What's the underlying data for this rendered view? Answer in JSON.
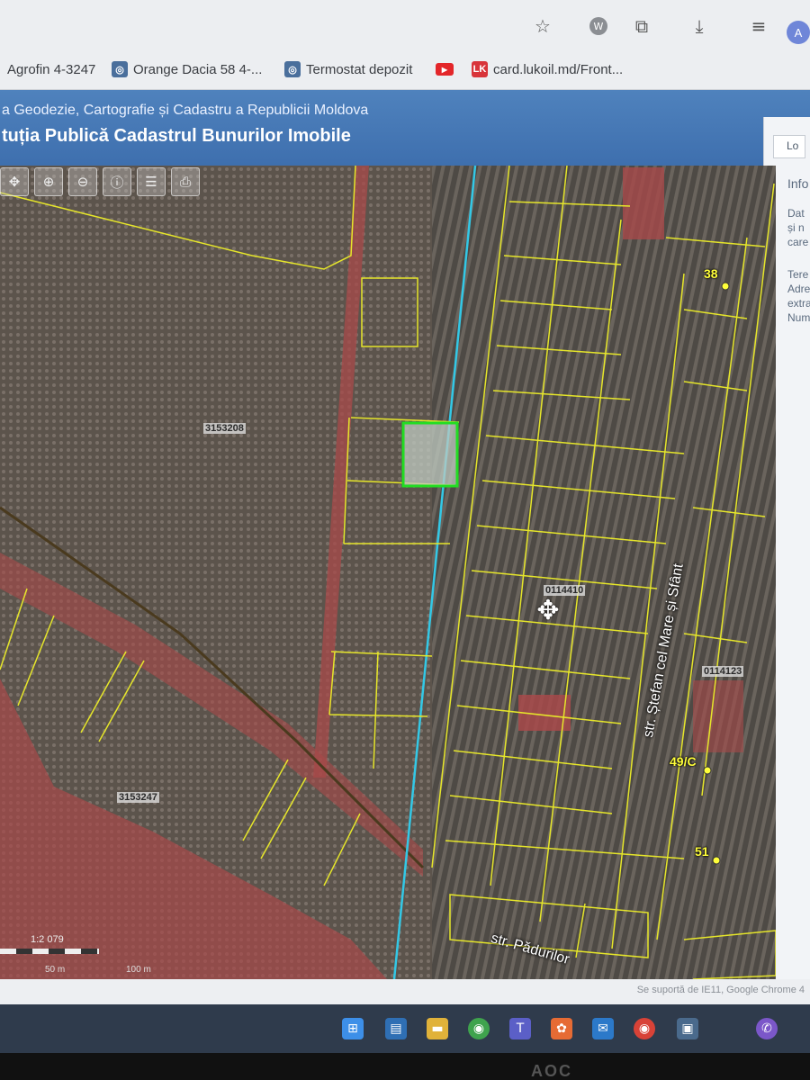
{
  "browser": {
    "toolbar_icons": [
      "star-icon",
      "extension-w-icon",
      "extensions-icon",
      "download-icon",
      "playlist-icon"
    ],
    "profile_initial": "A",
    "bookmarks": [
      {
        "label": "Agrofin 4-3247",
        "icon": "none"
      },
      {
        "label": "Orange Dacia 58  4-...",
        "icon": "site-icon"
      },
      {
        "label": "Termostat depozit",
        "icon": "site-icon"
      },
      {
        "label": "",
        "icon": "youtube-icon"
      },
      {
        "label": "card.lukoil.md/Front...",
        "icon": "lukoil-icon"
      }
    ]
  },
  "site": {
    "agency": "a Geodezie, Cartografie și Cadastru a Republicii Moldova",
    "institution": "tuția Publică Cadastrul Bunurilor Imobile"
  },
  "info_panel": {
    "tab_label": "Lo",
    "heading": "Info",
    "lines": [
      "Dat",
      "și n",
      "care",
      "Tere",
      "Adre",
      "extra",
      "Num"
    ]
  },
  "map": {
    "toolbar_tools": [
      "pan-icon",
      "zoom-in-icon",
      "zoom-out-icon",
      "identify-icon",
      "layers-icon",
      "print-icon"
    ],
    "cadastral_labels": [
      "3153208",
      "3153247",
      "0114410",
      "0114123"
    ],
    "address_labels": [
      "38",
      "49/C",
      "51"
    ],
    "streets": [
      "str. Ștefan cel Mare și Sfânt",
      "str. Pădurilor"
    ],
    "scale": {
      "ratio": "1:2 079",
      "labels": [
        "50 m",
        "100 m"
      ]
    },
    "colors": {
      "parcel_line": "#e6e62a",
      "highlight": "#22dd22",
      "red_zone": "#a8494a",
      "water_line": "#33c8e6"
    }
  },
  "status": {
    "text": "Se suportă de IE11, Google Chrome 4"
  },
  "taskbar": {
    "icons": [
      "windows-start-icon",
      "file-explorer-icon",
      "folder-icon",
      "chrome-green-icon",
      "teams-icon",
      "photos-icon",
      "mail-icon",
      "chrome-icon",
      "app-icon",
      "viber-icon"
    ]
  },
  "monitor": {
    "brand": "AOC"
  }
}
